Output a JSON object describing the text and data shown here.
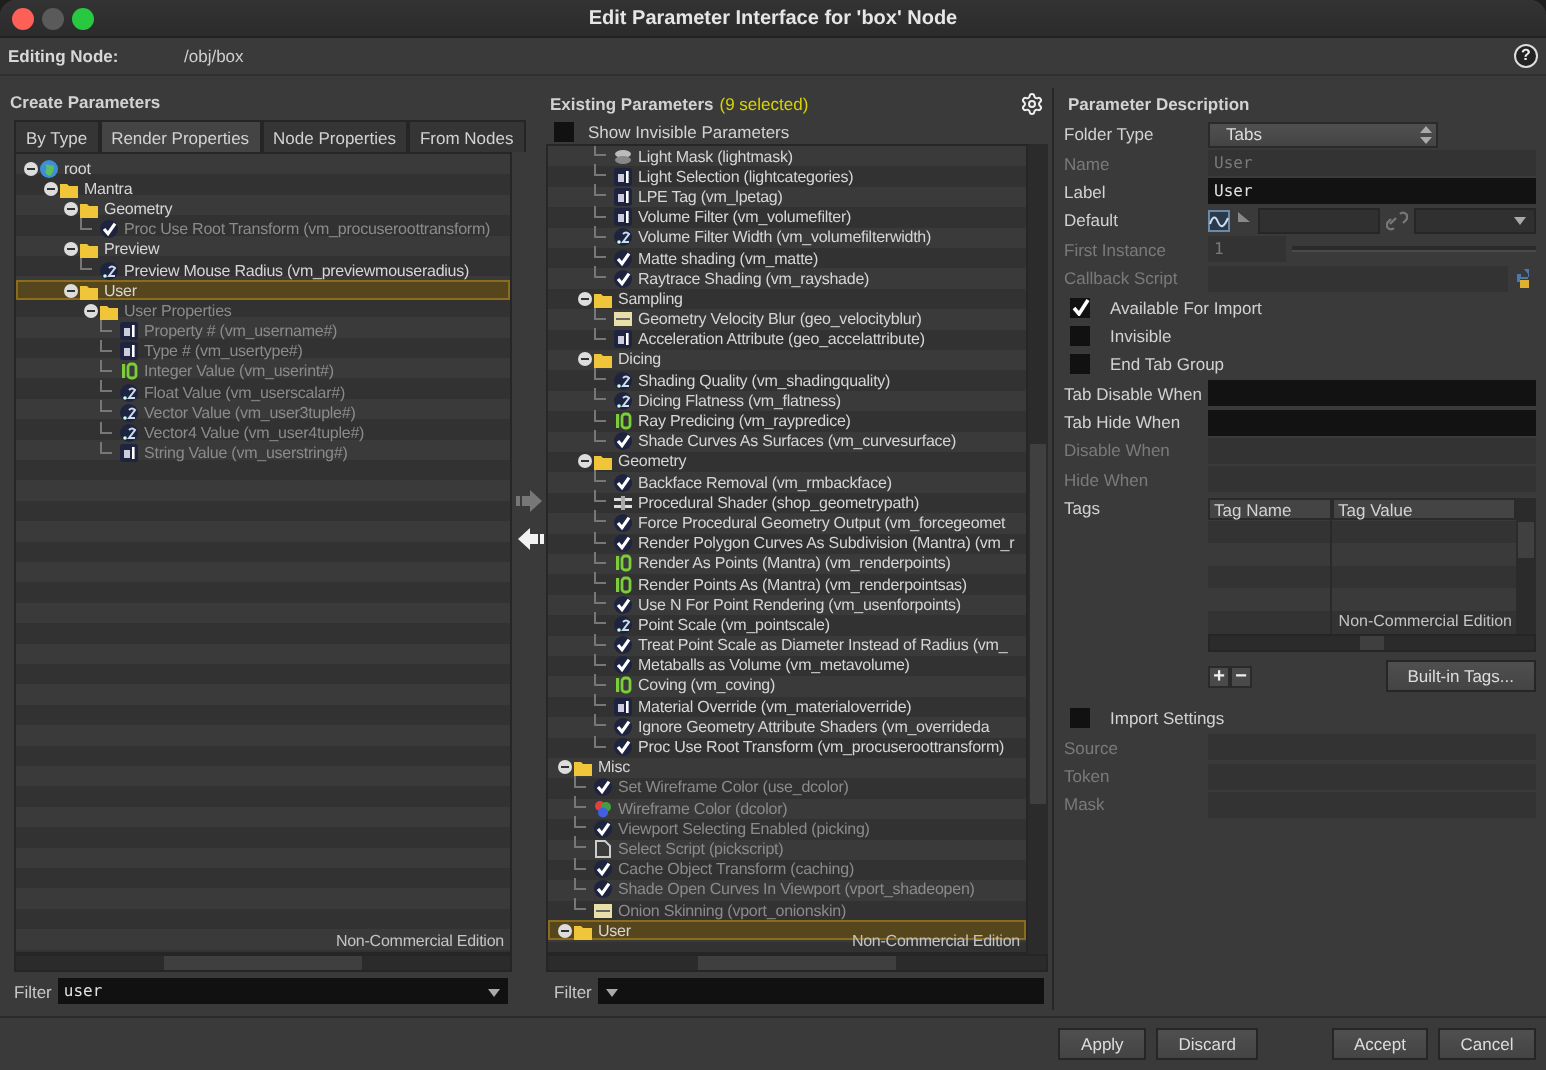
{
  "window": {
    "title": "Edit Parameter Interface for 'box' Node",
    "help_label": "?"
  },
  "editing_node": {
    "label": "Editing Node:",
    "value": "/obj/box"
  },
  "create_parameters": {
    "title": "Create Parameters",
    "tabs": [
      {
        "label": "By Type",
        "selected": false
      },
      {
        "label": "Render Properties",
        "selected": true
      },
      {
        "label": "Node Properties",
        "selected": false
      },
      {
        "label": "From Nodes",
        "selected": false
      }
    ],
    "tree": [
      {
        "label": "root",
        "kind": "globe",
        "expanded": true,
        "selected": false,
        "dim": false,
        "children": [
          {
            "label": "Mantra",
            "kind": "folder",
            "expanded": true,
            "selected": false,
            "dim": false,
            "children": [
              {
                "label": "Geometry",
                "kind": "folder",
                "expanded": true,
                "selected": false,
                "dim": false,
                "children": [
                  {
                    "label": "Proc Use Root Transform (vm_procuseroottransform)",
                    "kind": "toggle",
                    "selected": false,
                    "dim": true
                  }
                ]
              },
              {
                "label": "Preview",
                "kind": "folder",
                "expanded": true,
                "selected": false,
                "dim": false,
                "children": [
                  {
                    "label": "Preview Mouse Radius (vm_previewmouseradius)",
                    "kind": "float",
                    "selected": false,
                    "dim": false
                  }
                ]
              },
              {
                "label": "User",
                "kind": "folder",
                "expanded": true,
                "selected": true,
                "dim": false,
                "children": [
                  {
                    "label": "User Properties",
                    "kind": "folder",
                    "expanded": true,
                    "selected": false,
                    "dim": true,
                    "children": [
                      {
                        "label": "Property # (vm_username#)",
                        "kind": "string",
                        "selected": false,
                        "dim": true
                      },
                      {
                        "label": "Type # (vm_usertype#)",
                        "kind": "string",
                        "selected": false,
                        "dim": true
                      },
                      {
                        "label": "Integer Value (vm_userint#)",
                        "kind": "int",
                        "selected": false,
                        "dim": true
                      },
                      {
                        "label": "Float Value (vm_userscalar#)",
                        "kind": "float",
                        "selected": false,
                        "dim": true
                      },
                      {
                        "label": "Vector Value (vm_user3tuple#)",
                        "kind": "float",
                        "selected": false,
                        "dim": true
                      },
                      {
                        "label": "Vector4 Value (vm_user4tuple#)",
                        "kind": "float",
                        "selected": false,
                        "dim": true
                      },
                      {
                        "label": "String Value (vm_userstring#)",
                        "kind": "string",
                        "selected": false,
                        "dim": true
                      }
                    ]
                  }
                ]
              }
            ]
          }
        ]
      }
    ],
    "edition_note": "Non-Commercial Edition",
    "filter": {
      "label": "Filter",
      "value": "user"
    }
  },
  "transfer_buttons": [
    {
      "kind": "add",
      "disabled": true
    },
    {
      "kind": "remove",
      "disabled": false
    }
  ],
  "existing_parameters": {
    "title": "Existing Parameters",
    "count": "(9 selected)",
    "show_invisible": {
      "label": "Show Invisible Parameters",
      "checked": false
    },
    "tree": [
      {
        "children": [
          {
            "children": [
              {
                "label": "Light Mask (lightmask)",
                "kind": "lightmask",
                "selected": false,
                "dim": false
              },
              {
                "label": "Light Selection (lightcategories)",
                "kind": "string",
                "selected": false,
                "dim": false
              },
              {
                "label": "LPE Tag (vm_lpetag)",
                "kind": "string",
                "selected": false,
                "dim": false
              },
              {
                "label": "Volume Filter (vm_volumefilter)",
                "kind": "string",
                "selected": false,
                "dim": false
              },
              {
                "label": "Volume Filter Width (vm_volumefilterwidth)",
                "kind": "float",
                "selected": false,
                "dim": false
              },
              {
                "label": "Matte shading (vm_matte)",
                "kind": "toggle",
                "selected": false,
                "dim": false
              },
              {
                "label": "Raytrace Shading (vm_rayshade)",
                "kind": "toggle",
                "selected": false,
                "dim": false
              }
            ]
          },
          {
            "label": "Sampling",
            "kind": "folder",
            "expanded": true,
            "selected": false,
            "dim": false,
            "children": [
              {
                "label": "Geometry Velocity Blur (geo_velocityblur)",
                "kind": "menu",
                "selected": false,
                "dim": false
              },
              {
                "label": "Acceleration Attribute (geo_accelattribute)",
                "kind": "string",
                "selected": false,
                "dim": false
              }
            ]
          },
          {
            "label": "Dicing",
            "kind": "folder",
            "expanded": true,
            "selected": false,
            "dim": false,
            "children": [
              {
                "label": "Shading Quality (vm_shadingquality)",
                "kind": "float",
                "selected": false,
                "dim": false
              },
              {
                "label": "Dicing Flatness (vm_flatness)",
                "kind": "float",
                "selected": false,
                "dim": false
              },
              {
                "label": "Ray Predicing (vm_raypredice)",
                "kind": "int",
                "selected": false,
                "dim": false
              },
              {
                "label": "Shade Curves As Surfaces (vm_curvesurface)",
                "kind": "toggle",
                "selected": false,
                "dim": false
              }
            ]
          },
          {
            "label": "Geometry",
            "kind": "folder",
            "expanded": true,
            "selected": false,
            "dim": false,
            "children": [
              {
                "label": "Backface Removal (vm_rmbackface)",
                "kind": "toggle",
                "selected": false,
                "dim": false
              },
              {
                "label": "Procedural Shader (shop_geometrypath)",
                "kind": "shader",
                "selected": false,
                "dim": false
              },
              {
                "label": "Force Procedural Geometry Output (vm_forcegeomet",
                "kind": "toggle",
                "selected": false,
                "dim": false
              },
              {
                "label": "Render Polygon Curves As Subdivision (Mantra) (vm_r",
                "kind": "toggle",
                "selected": false,
                "dim": false
              },
              {
                "label": "Render As Points (Mantra) (vm_renderpoints)",
                "kind": "int",
                "selected": false,
                "dim": false
              },
              {
                "label": "Render Points As (Mantra) (vm_renderpointsas)",
                "kind": "int",
                "selected": false,
                "dim": false
              },
              {
                "label": "Use N For Point Rendering (vm_usenforpoints)",
                "kind": "toggle",
                "selected": false,
                "dim": false
              },
              {
                "label": "Point Scale (vm_pointscale)",
                "kind": "float",
                "selected": false,
                "dim": false
              },
              {
                "label": "Treat Point Scale as Diameter Instead of Radius (vm_",
                "kind": "toggle",
                "selected": false,
                "dim": false
              },
              {
                "label": "Metaballs as Volume (vm_metavolume)",
                "kind": "toggle",
                "selected": false,
                "dim": false
              },
              {
                "label": "Coving (vm_coving)",
                "kind": "int",
                "selected": false,
                "dim": false
              },
              {
                "label": "Material Override (vm_materialoverride)",
                "kind": "string",
                "selected": false,
                "dim": false
              },
              {
                "label": "Ignore Geometry Attribute Shaders (vm_overrideda",
                "kind": "toggle",
                "selected": false,
                "dim": false
              },
              {
                "label": "Proc Use Root Transform (vm_procuseroottransform)",
                "kind": "toggle",
                "selected": false,
                "dim": false
              }
            ]
          }
        ]
      },
      {
        "label": "Misc",
        "kind": "folder",
        "expanded": true,
        "selected": false,
        "dim": false,
        "children": [
          {
            "label": "Set Wireframe Color (use_dcolor)",
            "kind": "toggle",
            "selected": false,
            "dim": true
          },
          {
            "label": "Wireframe Color (dcolor)",
            "kind": "color",
            "selected": false,
            "dim": true
          },
          {
            "label": "Viewport Selecting Enabled (picking)",
            "kind": "toggle",
            "selected": false,
            "dim": true
          },
          {
            "label": "Select Script (pickscript)",
            "kind": "file",
            "selected": false,
            "dim": true
          },
          {
            "label": "Cache Object Transform (caching)",
            "kind": "toggle",
            "selected": false,
            "dim": true
          },
          {
            "label": "Shade Open Curves In Viewport (vport_shadeopen)",
            "kind": "toggle",
            "selected": false,
            "dim": true
          },
          {
            "label": "Onion Skinning (vport_onionskin)",
            "kind": "menu",
            "selected": false,
            "dim": true
          }
        ]
      },
      {
        "label": "User",
        "kind": "folder",
        "expanded": true,
        "selected": true,
        "dim": false
      }
    ],
    "edition_note": "Non-Commercial Edition",
    "filter": {
      "label": "Filter"
    }
  },
  "parameter_description": {
    "title": "Parameter Description",
    "rows": [
      {
        "kind": "dropdown",
        "label": "Folder Type",
        "value": "Tabs",
        "disabled": false
      },
      {
        "kind": "text",
        "label": "Name",
        "value": "User",
        "disabled": true
      },
      {
        "kind": "text",
        "label": "Label",
        "value": "User",
        "disabled": false
      },
      {
        "kind": "default",
        "label": "Default",
        "disabled": false
      },
      {
        "kind": "slider",
        "label": "First Instance",
        "value": "1",
        "disabled": true
      },
      {
        "kind": "script",
        "label": "Callback Script",
        "disabled": true
      },
      {
        "kind": "checkbox",
        "label": "Available For Import",
        "checked": true
      },
      {
        "kind": "checkbox",
        "label": "Invisible",
        "checked": false
      },
      {
        "kind": "checkbox",
        "label": "End Tab Group",
        "checked": false
      },
      {
        "kind": "text",
        "label": "Tab Disable When",
        "disabled": false
      },
      {
        "kind": "text",
        "label": "Tab Hide When",
        "disabled": false
      },
      {
        "kind": "text",
        "label": "Disable When",
        "disabled": true
      },
      {
        "kind": "text",
        "label": "Hide When",
        "disabled": true
      },
      {
        "kind": "tags",
        "label": "Tags",
        "columns": [
          "Tag Name",
          "Tag Value"
        ],
        "edition_note": "Non-Commercial Edition",
        "add_label": "+",
        "remove_label": "−",
        "builtin_button": "Built-in Tags..."
      },
      {
        "kind": "checkbox",
        "label": "Import Settings",
        "checked": false
      },
      {
        "kind": "text",
        "label": "Source",
        "disabled": true
      },
      {
        "kind": "text",
        "label": "Token",
        "disabled": true
      },
      {
        "kind": "text",
        "label": "Mask",
        "disabled": true
      }
    ]
  },
  "buttons": [
    {
      "label": "Apply"
    },
    {
      "label": "Discard"
    },
    {
      "label": "Accept"
    },
    {
      "label": "Cancel"
    }
  ]
}
